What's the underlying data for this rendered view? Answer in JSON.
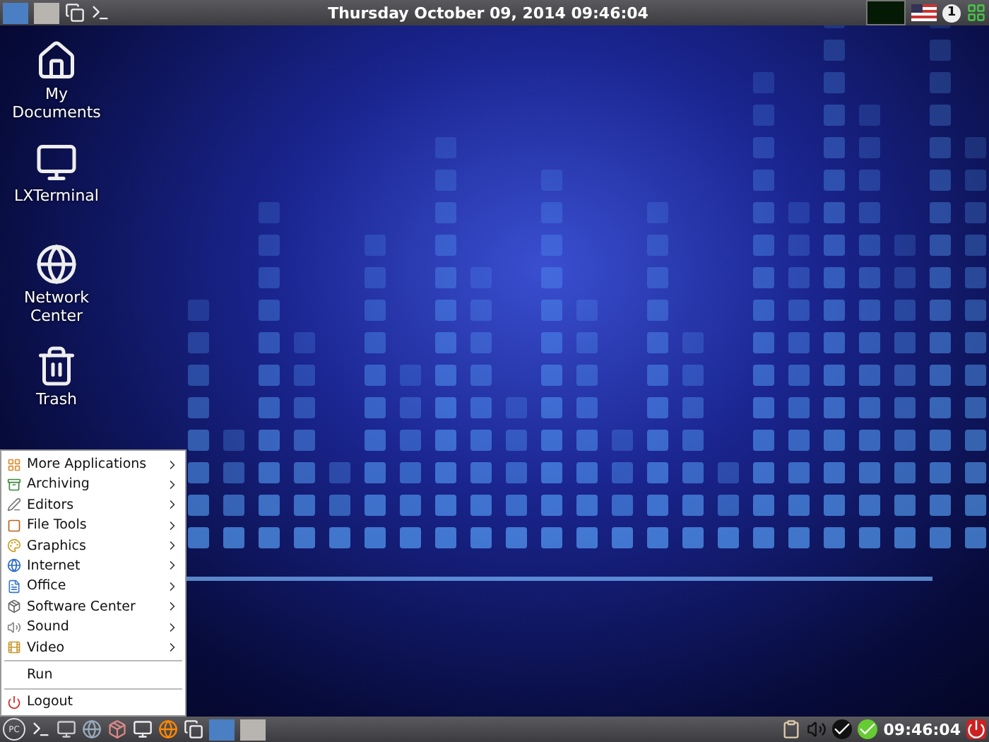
{
  "top_panel": {
    "workspaces": [
      {
        "selected": true
      },
      {
        "selected": false
      }
    ],
    "clock": "Thursday October 09, 2014 09:46:04",
    "tray_badge": "1"
  },
  "desktop_icons": [
    {
      "kind": "home",
      "label": "My Documents"
    },
    {
      "kind": "monitor",
      "label": "LXTerminal"
    },
    {
      "kind": "network",
      "label": "Network Center"
    },
    {
      "kind": "trash",
      "label": "Trash"
    }
  ],
  "menu": {
    "sections": [
      [
        {
          "label": "More Applications",
          "kind": "submenu"
        },
        {
          "label": "Archiving",
          "kind": "submenu"
        },
        {
          "label": "Editors",
          "kind": "submenu"
        },
        {
          "label": "File Tools",
          "kind": "submenu"
        },
        {
          "label": "Graphics",
          "kind": "submenu"
        },
        {
          "label": "Internet",
          "kind": "submenu"
        },
        {
          "label": "Office",
          "kind": "submenu"
        },
        {
          "label": "Software Center",
          "kind": "submenu"
        },
        {
          "label": "Sound",
          "kind": "submenu"
        },
        {
          "label": "Video",
          "kind": "submenu"
        }
      ],
      [
        {
          "label": "Run",
          "kind": "action"
        }
      ],
      [
        {
          "label": "Logout",
          "kind": "action"
        }
      ]
    ]
  },
  "bottom_panel": {
    "start": "PC",
    "workspaces": [
      {
        "selected": true
      },
      {
        "selected": false
      }
    ],
    "clock": "09:46:04"
  }
}
